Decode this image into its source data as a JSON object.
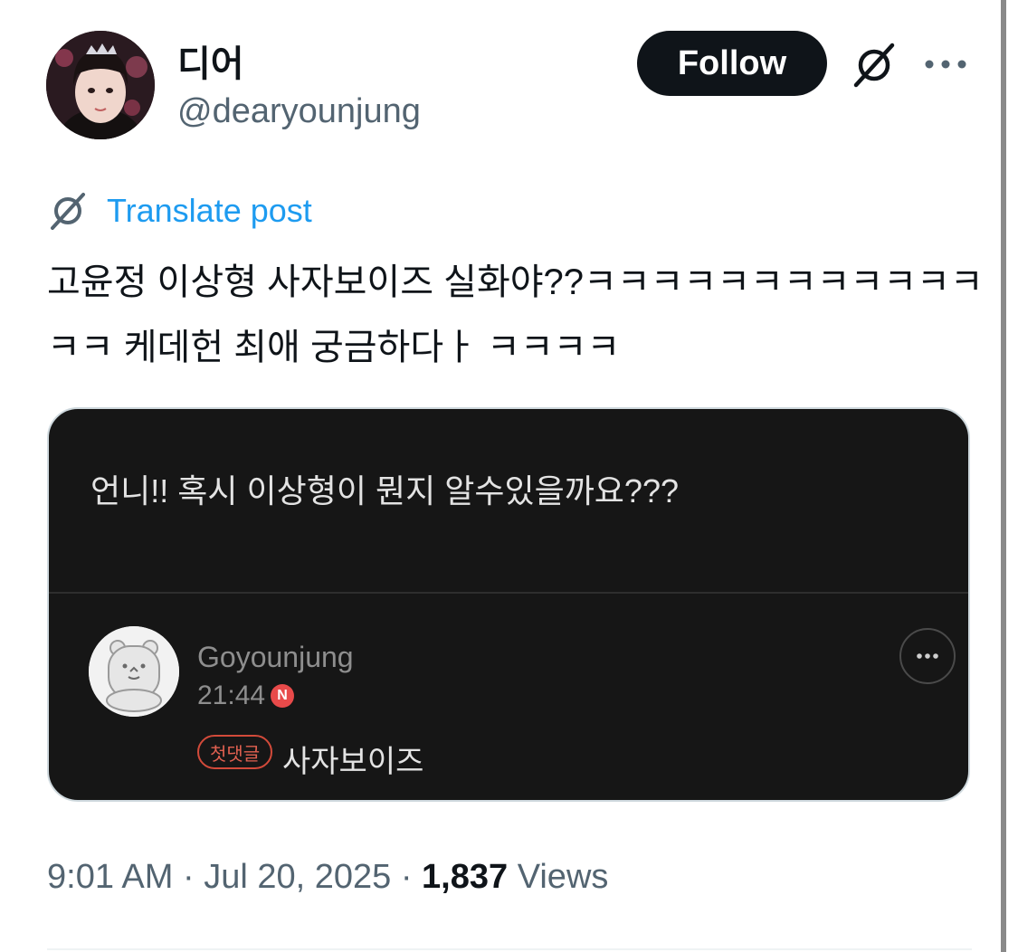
{
  "header": {
    "display_name": "디어",
    "handle": "@dearyounjung",
    "follow_label": "Follow"
  },
  "translate": {
    "label": "Translate post"
  },
  "post": {
    "text": "고윤정 이상형 사자보이즈 실화야??ㅋㅋㅋㅋㅋㅋㅋㅋㅋㅋㅋㅋㅋㅋ 케데헌 최애 궁금하다ㅏ ㅋㅋㅋㅋ"
  },
  "media": {
    "question": "언니!! 혹시 이상형이 뭔지 알수있을까요???",
    "comment": {
      "author": "Goyounjung",
      "time": "21:44",
      "new_badge": "N",
      "first_comment_badge": "첫댓글",
      "body": "사자보이즈"
    }
  },
  "meta": {
    "time": "9:01 AM",
    "separator": " · ",
    "date": "Jul 20, 2025",
    "views_count": "1,837",
    "views_label": "Views"
  },
  "colors": {
    "link_blue": "#1d9bf0",
    "secondary_text": "#536471",
    "primary_text": "#0f1419",
    "media_bg": "#161616",
    "badge_red": "#e84a4a"
  }
}
